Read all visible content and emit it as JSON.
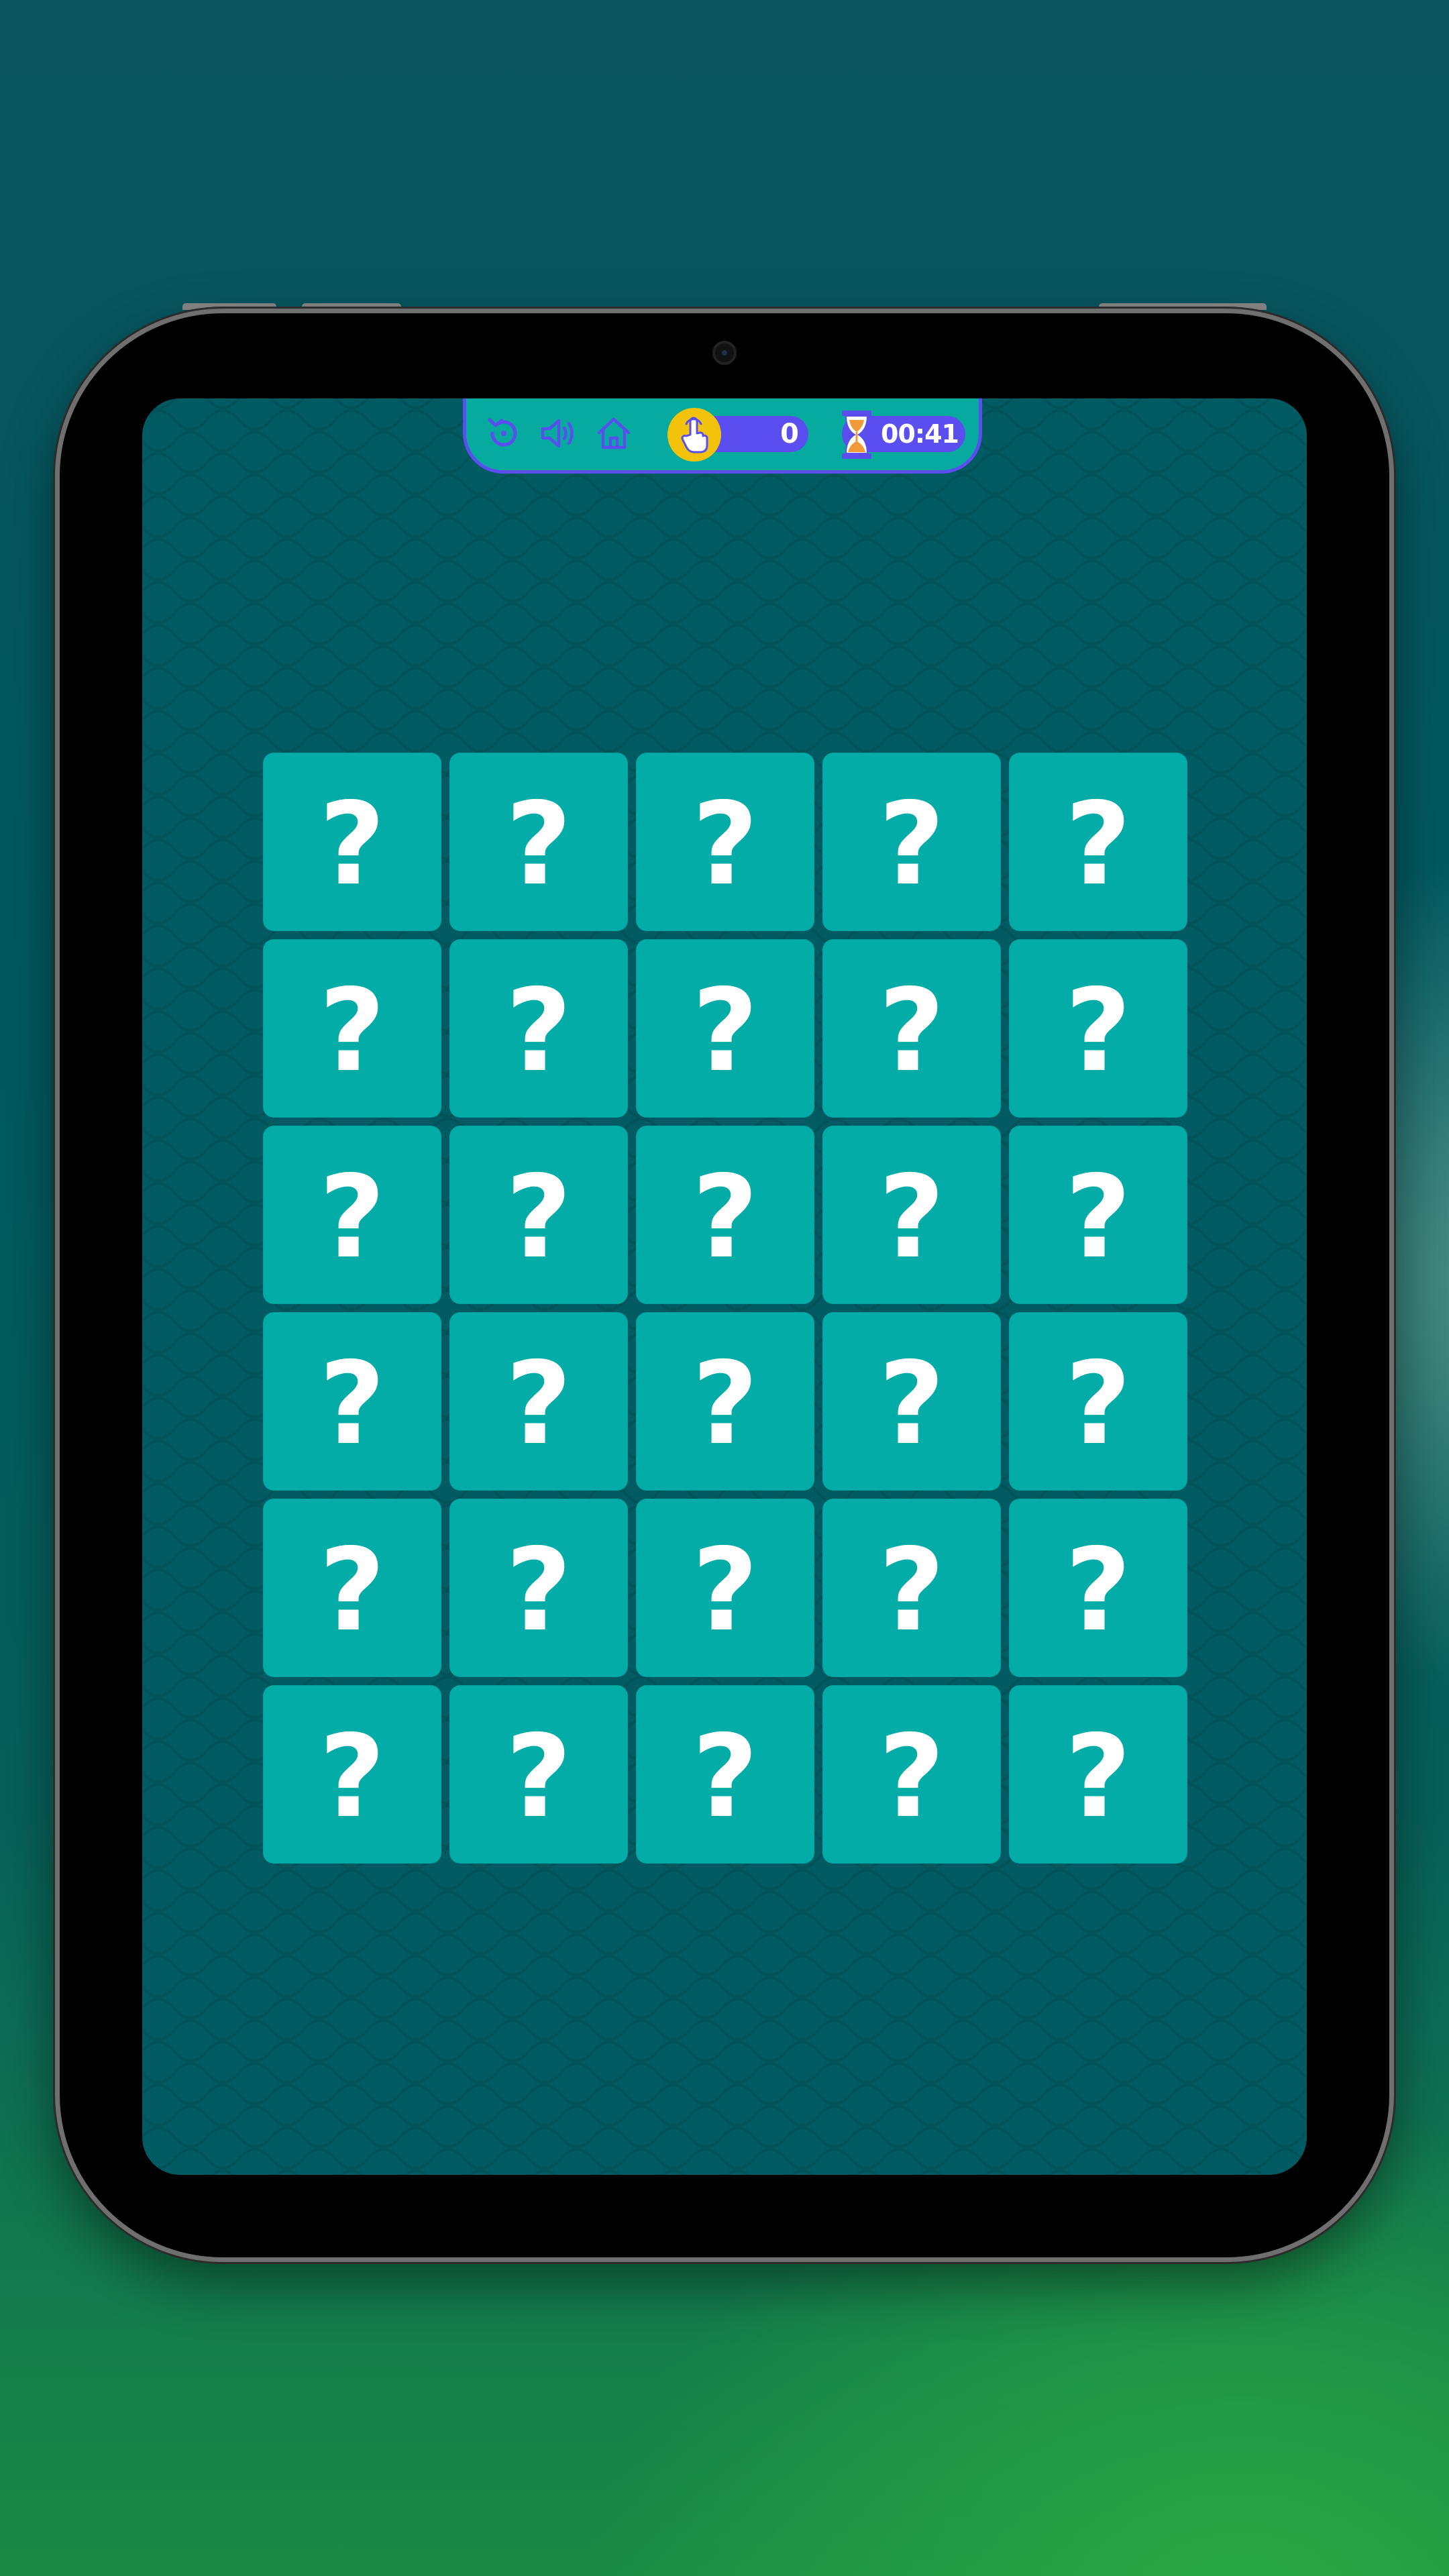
{
  "hud": {
    "icons": {
      "restart": "restart-icon",
      "sound": "speaker-icon",
      "home": "home-icon",
      "clicks": "tap-hand-icon",
      "timer": "hourglass-icon"
    },
    "clicks": "0",
    "timer": "00:41"
  },
  "board": {
    "rows": 6,
    "columns": 5,
    "cards": [
      "?",
      "?",
      "?",
      "?",
      "?",
      "?",
      "?",
      "?",
      "?",
      "?",
      "?",
      "?",
      "?",
      "?",
      "?",
      "?",
      "?",
      "?",
      "?",
      "?",
      "?",
      "?",
      "?",
      "?",
      "?",
      "?",
      "?",
      "?",
      "?",
      "?"
    ]
  },
  "colors": {
    "card": "#03aca6",
    "screen": "#025a62",
    "hud": "#06aa9f",
    "hud_accent": "#5b4ef0",
    "clicks_badge": "#f2c30a"
  }
}
